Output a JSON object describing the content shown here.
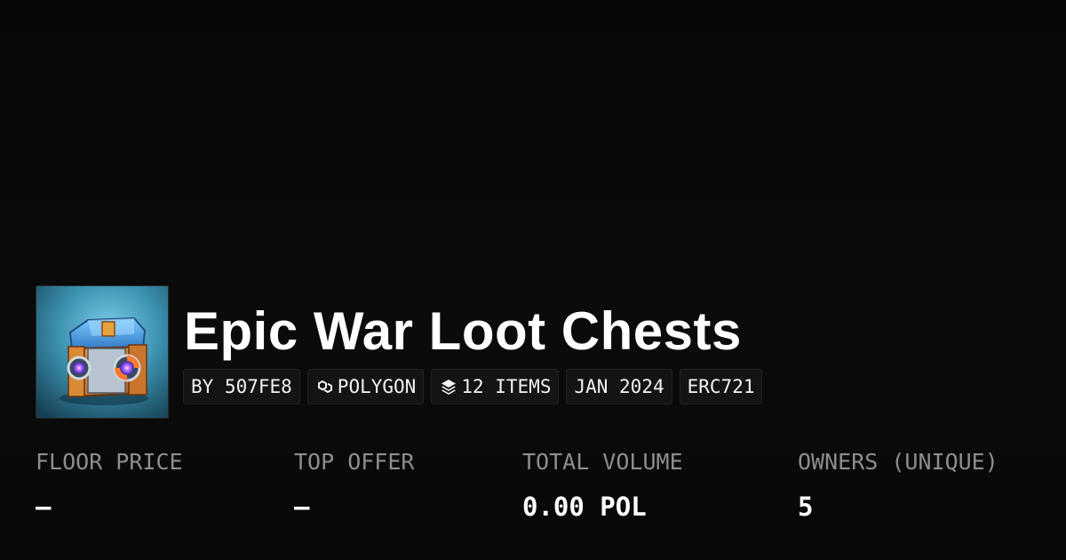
{
  "collection": {
    "title": "Epic War Loot Chests",
    "image_icon": "treasure-chest-image"
  },
  "tags": [
    {
      "label": "BY 507FE8",
      "icon": null
    },
    {
      "label": "POLYGON",
      "icon": "polygon-chain-icon"
    },
    {
      "label": "12 ITEMS",
      "icon": "stack-layers-icon"
    },
    {
      "label": "JAN 2024",
      "icon": null
    },
    {
      "label": "ERC721",
      "icon": null
    }
  ],
  "stats": [
    {
      "label": "FLOOR PRICE",
      "value": "–"
    },
    {
      "label": "TOP OFFER",
      "value": "–"
    },
    {
      "label": "TOTAL VOLUME",
      "value": "0.00 POL"
    },
    {
      "label": "OWNERS (UNIQUE)",
      "value": "5"
    }
  ],
  "colors": {
    "background": "#0b0b0b",
    "label": "#8d8d8d",
    "value": "#ffffff",
    "tag_bg": "#141414"
  }
}
